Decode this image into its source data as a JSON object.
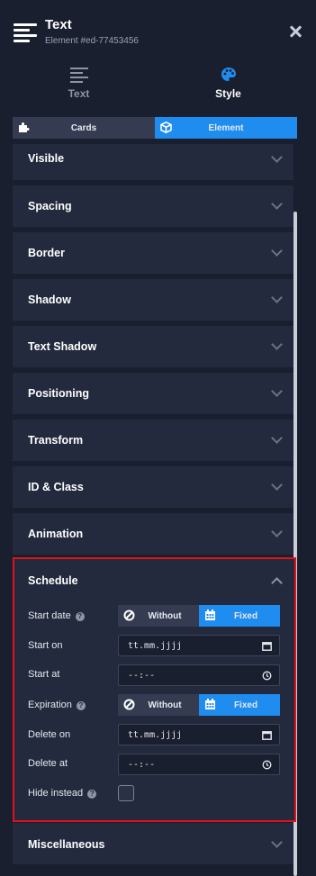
{
  "header": {
    "title": "Text",
    "subtitle": "Element #ed-77453456"
  },
  "tabs": [
    {
      "label": "Text",
      "icon": "text-align-icon"
    },
    {
      "label": "Style",
      "icon": "palette-icon"
    }
  ],
  "segments": [
    {
      "label": "Cards",
      "icon": "puzzle-icon"
    },
    {
      "label": "Element",
      "icon": "cube-icon"
    }
  ],
  "sections": {
    "visible": "Visible",
    "spacing": "Spacing",
    "border": "Border",
    "shadow": "Shadow",
    "text_shadow": "Text Shadow",
    "positioning": "Positioning",
    "transform": "Transform",
    "id_class": "ID & Class",
    "animation": "Animation",
    "schedule": "Schedule",
    "miscellaneous": "Miscellaneous"
  },
  "schedule": {
    "start_date_label": "Start date",
    "start_on_label": "Start on",
    "start_at_label": "Start at",
    "expiration_label": "Expiration",
    "delete_on_label": "Delete on",
    "delete_at_label": "Delete at",
    "hide_instead_label": "Hide instead",
    "without_label": "Without",
    "fixed_label": "Fixed",
    "date_placeholder": "tt.mm.jjjj",
    "time_placeholder": "--:--",
    "hide_instead_checked": false
  },
  "colors": {
    "accent": "#1f8cf0",
    "highlight": "#e0111a",
    "background": "#1a1f30",
    "panel": "#232a3d"
  }
}
